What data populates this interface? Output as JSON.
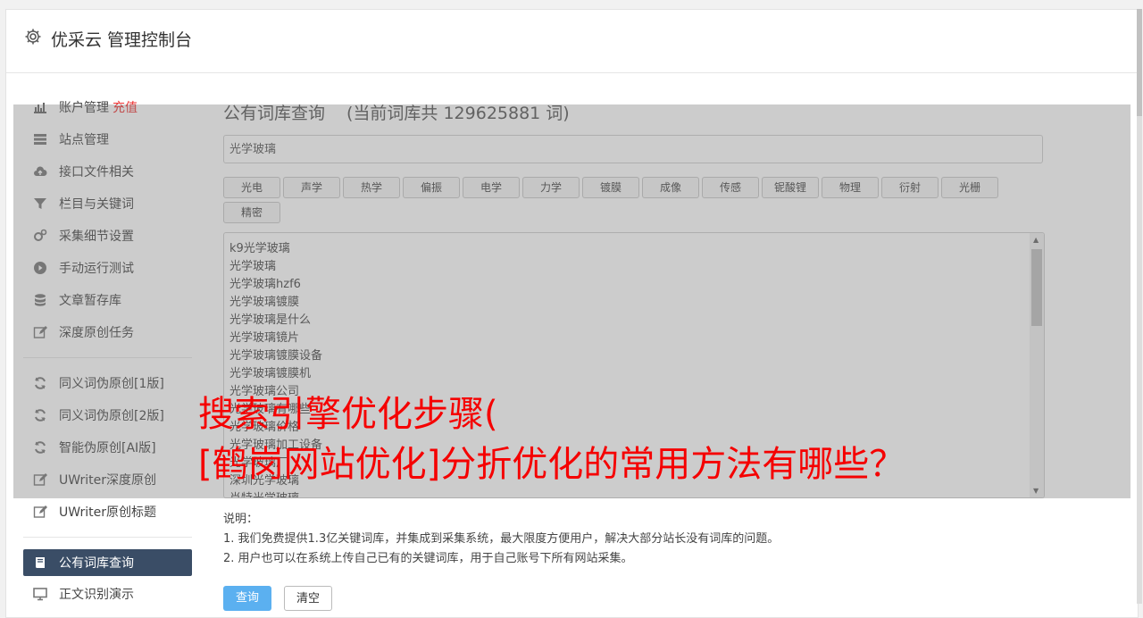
{
  "header": {
    "title": "优采云 管理控制台",
    "icon": "gear-icon"
  },
  "sidebar": {
    "items": [
      {
        "label": "账户管理",
        "badge": "充值",
        "icon": "bar-chart-icon"
      },
      {
        "label": "站点管理",
        "icon": "server-icon"
      },
      {
        "label": "接口文件相关",
        "icon": "cloud-upload-icon"
      },
      {
        "label": "栏目与关键词",
        "icon": "filter-icon"
      },
      {
        "label": "采集细节设置",
        "icon": "cogs-icon"
      },
      {
        "label": "手动运行测试",
        "icon": "play-circle-icon"
      },
      {
        "label": "文章暂存库",
        "icon": "database-icon"
      },
      {
        "label": "深度原创任务",
        "icon": "edit-icon"
      }
    ],
    "items2": [
      {
        "label": "同义词伪原创[1版]",
        "icon": "refresh-icon"
      },
      {
        "label": "同义词伪原创[2版]",
        "icon": "refresh-icon"
      },
      {
        "label": "智能伪原创[AI版]",
        "icon": "refresh-icon"
      },
      {
        "label": "UWriter深度原创",
        "icon": "edit-icon"
      },
      {
        "label": "UWriter原创标题",
        "icon": "edit-icon"
      }
    ],
    "items3": [
      {
        "label": "公有词库查询",
        "icon": "book-icon",
        "active": true
      },
      {
        "label": "正文识别演示",
        "icon": "monitor-icon"
      }
    ]
  },
  "main": {
    "title": "公有词库查询",
    "count_text": "(当前词库共 129625881 词)",
    "search_value": "光学玻璃",
    "tags": [
      "光电",
      "声学",
      "热学",
      "偏振",
      "电学",
      "力学",
      "镀膜",
      "成像",
      "传感",
      "铌酸锂",
      "物理",
      "衍射",
      "光栅",
      "精密"
    ],
    "results": [
      "k9光学玻璃",
      "光学玻璃",
      "光学玻璃hzf6",
      "光学玻璃镀膜",
      "光学玻璃是什么",
      "光学玻璃镜片",
      "光学玻璃镀膜设备",
      "光学玻璃镀膜机",
      "光学玻璃公司",
      "光学玻璃有哪些",
      "光学玻璃价格",
      "光学玻璃加工设备",
      "光学玻璃厂",
      "深圳光学玻璃",
      "肖特光学玻璃"
    ],
    "notes_title": "说明：",
    "notes": [
      "1. 我们免费提供1.3亿关键词库，并集成到采集系统，最大限度方便用户，解决大部分站长没有词库的问题。",
      "2. 用户也可以在系统上传自己已有的关键词库，用于自己账号下所有网站采集。"
    ],
    "query_button": "查询",
    "clear_button": "清空"
  },
  "overlay": {
    "line1": "搜索引擎优化步骤(",
    "line2": "[鹤岗网站优化]分折优化的常用方法有哪些？",
    "color": "#f50000"
  }
}
